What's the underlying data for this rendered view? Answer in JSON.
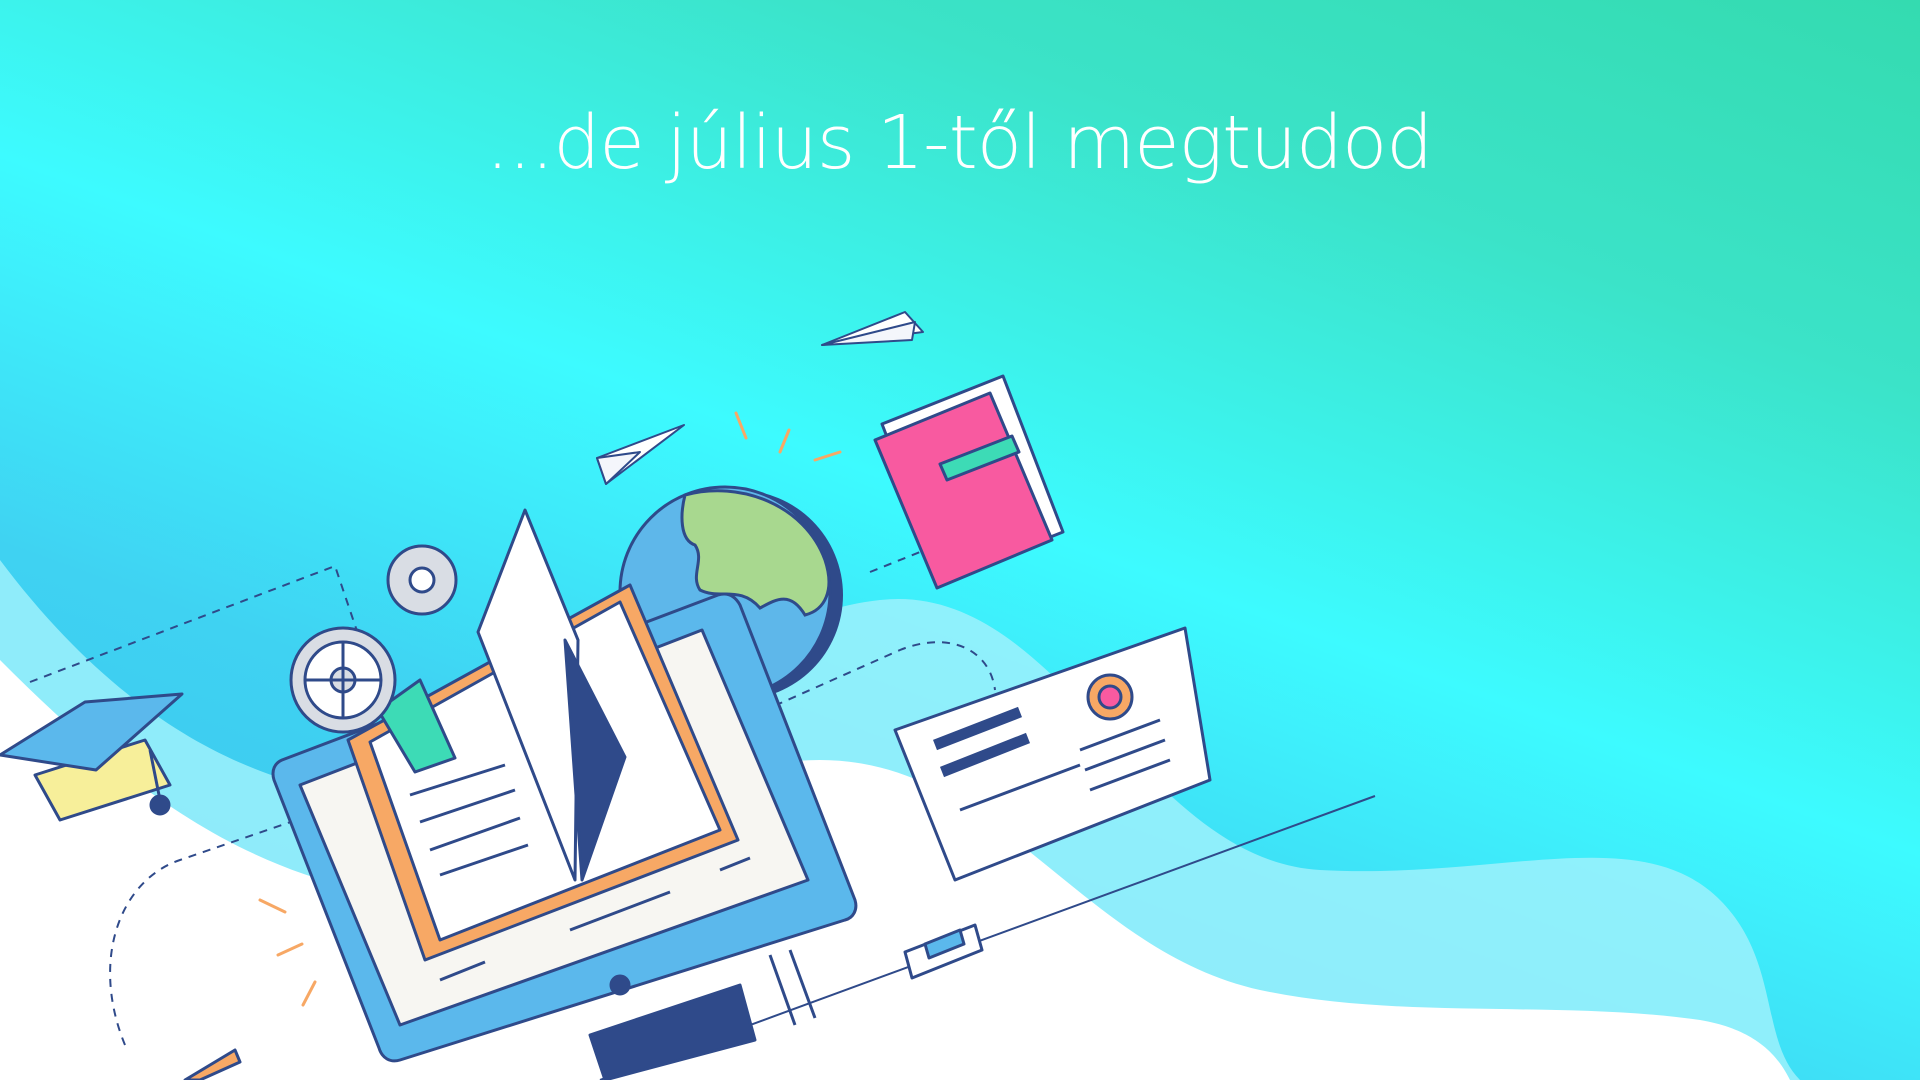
{
  "headline": "...de július 1-től megtudod",
  "colors": {
    "background_top": "#34dbb0",
    "background_mid": "#3dfbff",
    "background_bottom": "#39c0ec",
    "wave_light": "#9ef1fb",
    "wave_white": "#ffffff",
    "outline": "#2f4a8a",
    "monitor_blue": "#5bb8ec",
    "book_orange": "#f7a865",
    "accent_green": "#3ddbb6",
    "notebook_pink": "#f85aa0",
    "globe_green": "#a8d88f",
    "globe_blue": "#5eb7ea",
    "gear_gray": "#d9dde4",
    "cap_yellow": "#f7ef9a"
  },
  "icons": [
    "monitor-icon",
    "open-book-icon",
    "globe-icon",
    "notebook-icon",
    "certificate-icon",
    "graduation-cap-icon",
    "gear-icon",
    "paper-plane-icon",
    "pencil-icon",
    "stamp-icon"
  ]
}
